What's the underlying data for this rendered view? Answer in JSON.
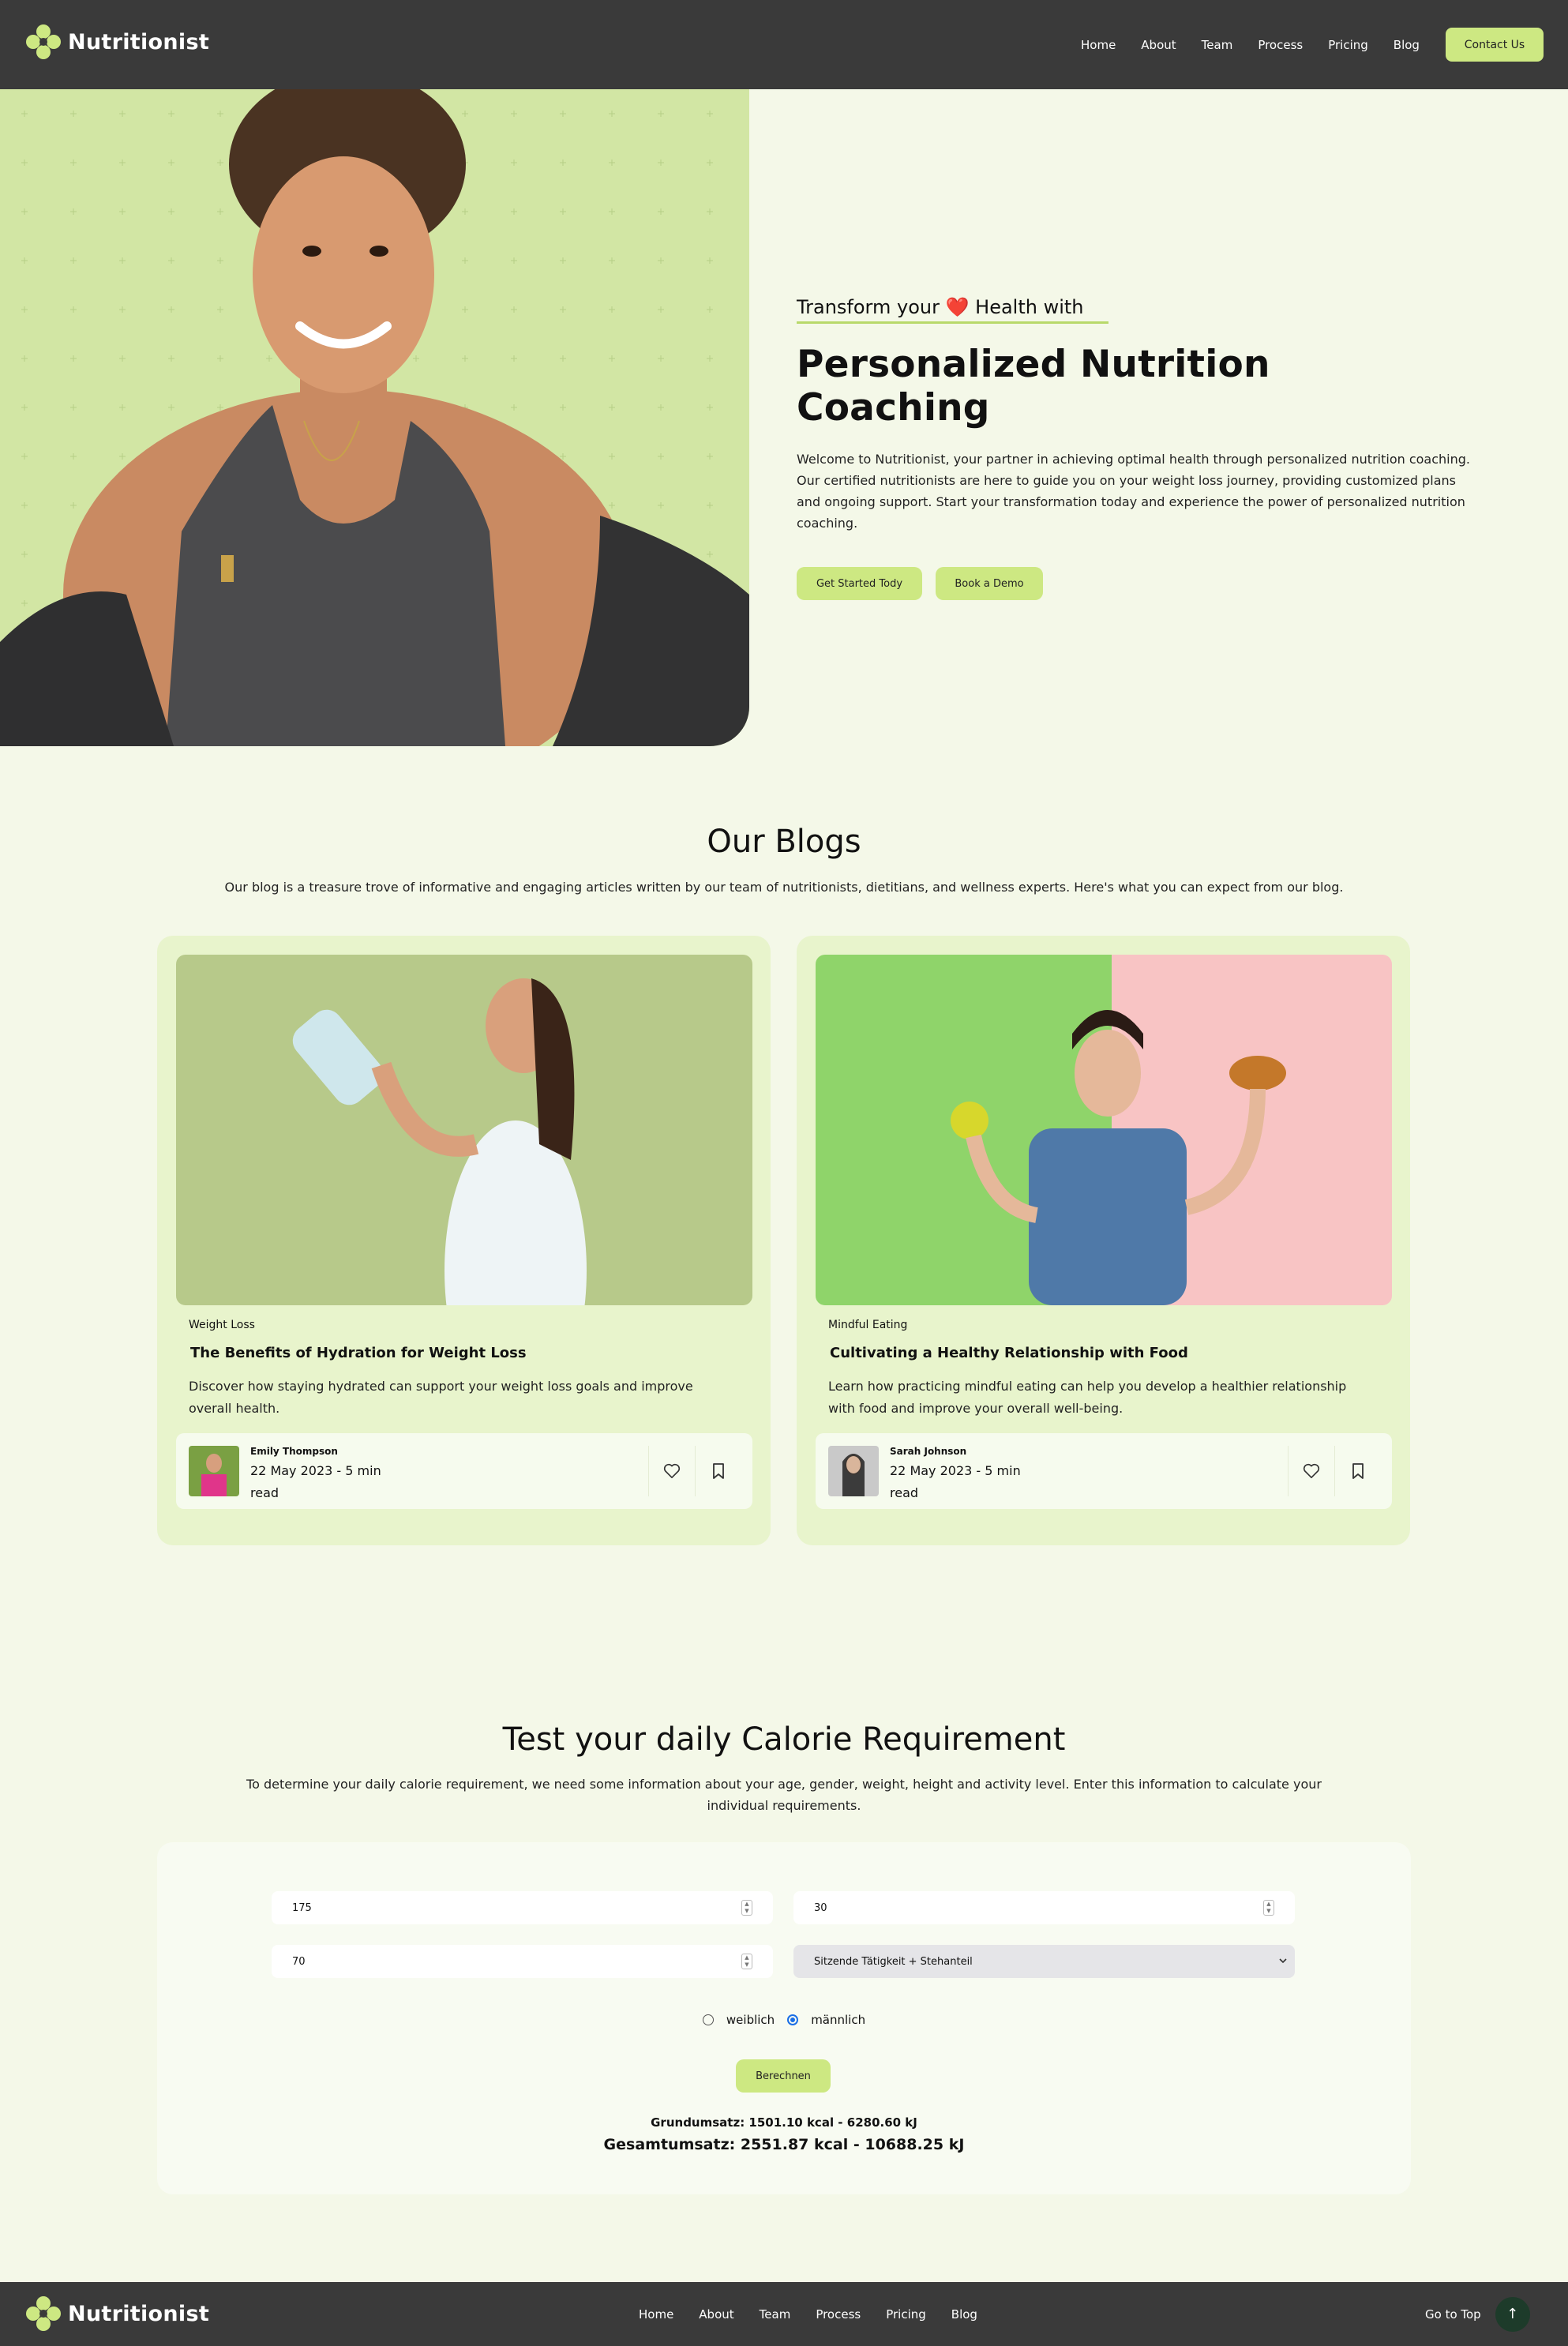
{
  "brand": {
    "name": "Nutritionist",
    "accent": "#cde882",
    "dark": "#3a3a3a"
  },
  "nav": {
    "links": [
      "Home",
      "About",
      "Team",
      "Process",
      "Pricing",
      "Blog"
    ],
    "contact_label": "Contact Us"
  },
  "hero": {
    "pre_title_a": "Transform your",
    "pre_title_heart": "❤️",
    "pre_title_b": "Health with",
    "title": "Personalized Nutrition Coaching",
    "description": "Welcome to Nutritionist, your partner in achieving optimal health through personalized nutrition coaching. Our certified nutritionists are here to guide you on your weight loss journey, providing customized plans and ongoing support. Start your transformation today and experience the power of personalized nutrition coaching.",
    "primary_cta": "Get Started Tody",
    "secondary_cta": "Book a Demo"
  },
  "blogs": {
    "title": "Our Blogs",
    "description": "Our blog is a treasure trove of informative and engaging articles written by our team of nutritionists, dietitians, and wellness experts. Here's what you can expect from our blog.",
    "posts": [
      {
        "category": "Weight Loss",
        "title": "The Benefits of Hydration for Weight Loss",
        "excerpt": "Discover how staying hydrated can support your weight loss goals and improve overall health.",
        "author": "Emily Thompson",
        "meta": "22 May 2023 - 5 min read"
      },
      {
        "category": "Mindful Eating",
        "title": "Cultivating a Healthy Relationship with Food",
        "excerpt": "Learn how practicing mindful eating can help you develop a healthier relationship with food and improve your overall well-being.",
        "author": "Sarah Johnson",
        "meta": "22 May 2023 - 5 min read"
      }
    ]
  },
  "calculator": {
    "title": "Test your daily Calorie Requirement",
    "description": "To determine your daily calorie requirement, we need some information about your age, gender, weight, height and activity level. Enter this information to calculate your individual requirements.",
    "height": "175",
    "age": "30",
    "weight": "70",
    "activity": "Sitzende Tätigkeit + Stehanteil",
    "gender_female": "weiblich",
    "gender_male": "männlich",
    "selected_gender": "männlich",
    "submit_label": "Berechnen",
    "result_basal": "Grundumsatz: 1501.10 kcal - 6280.60 kJ",
    "result_total": "Gesamtumsatz: 2551.87 kcal - 10688.25 kJ"
  },
  "footer": {
    "links": [
      "Home",
      "About",
      "Team",
      "Process",
      "Pricing",
      "Blog"
    ],
    "goto_top": "Go to Top",
    "goto_icon": "arrow-up-icon"
  }
}
